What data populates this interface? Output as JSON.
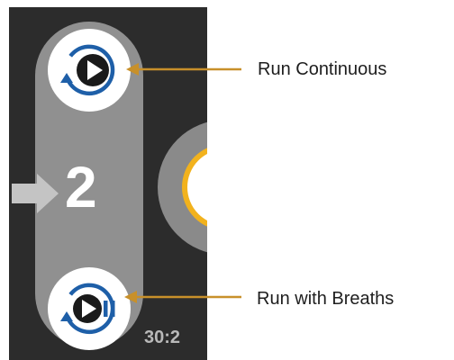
{
  "device": {
    "current_step": "2",
    "compression_ratio": "30:2",
    "colors": {
      "panel_bg": "#2c2c2c",
      "pill_bg": "#909090",
      "icon_blue": "#1e5fa8",
      "icon_dark": "#1a1a1a",
      "dial_ring": "#f2b21d",
      "leader_line": "#c8902a"
    }
  },
  "buttons": {
    "continuous": {
      "icon": "run-continuous-icon"
    },
    "breaths": {
      "icon": "run-with-breaths-icon"
    }
  },
  "callouts": {
    "continuous_label": "Run Continuous",
    "breaths_label": "Run with Breaths"
  }
}
